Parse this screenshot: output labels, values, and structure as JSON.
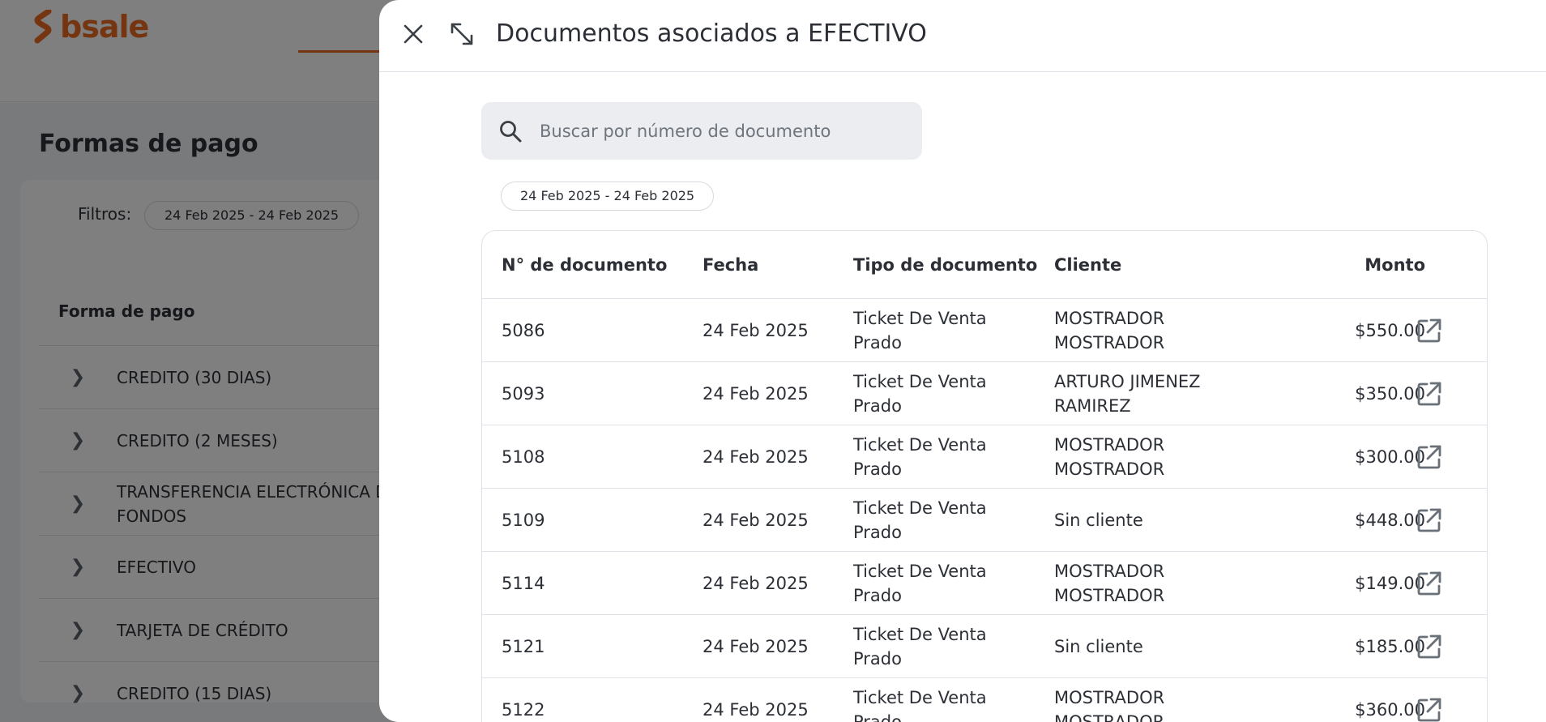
{
  "background": {
    "logo_text": "bsale",
    "page_title": "Formas de pago",
    "filters_label": "Filtros:",
    "filter_chip": "24 Feb 2025 - 24 Feb 2025",
    "column_header": "Forma de pago",
    "payment_methods": [
      {
        "label": "CREDITO (30 DIAS)"
      },
      {
        "label": "CREDITO (2 MESES)"
      },
      {
        "label": "TRANSFERENCIA ELECTRÓNICA DE",
        "label2": "FONDOS"
      },
      {
        "label": "EFECTIVO"
      },
      {
        "label": "TARJETA DE CRÉDITO"
      },
      {
        "label": "CREDITO (15 DIAS)"
      }
    ]
  },
  "modal": {
    "title": "Documentos asociados a EFECTIVO",
    "close_icon": "close-icon",
    "expand_icon": "expand-icon",
    "search": {
      "placeholder": "Buscar por número de documento",
      "value": ""
    },
    "date_chip": "24 Feb 2025 - 24 Feb 2025",
    "table": {
      "headers": {
        "doc_number": "N° de documento",
        "date": "Fecha",
        "doc_type": "Tipo de documento",
        "client": "Cliente",
        "amount": "Monto"
      },
      "rows": [
        {
          "doc_number": "5086",
          "date": "24 Feb 2025",
          "doc_type": "Ticket De Venta Prado",
          "client": "MOSTRADOR MOSTRADOR",
          "amount": "$550.00"
        },
        {
          "doc_number": "5093",
          "date": "24 Feb 2025",
          "doc_type": "Ticket De Venta Prado",
          "client": "ARTURO JIMENEZ RAMIREZ",
          "amount": "$350.00"
        },
        {
          "doc_number": "5108",
          "date": "24 Feb 2025",
          "doc_type": "Ticket De Venta Prado",
          "client": "MOSTRADOR MOSTRADOR",
          "amount": "$300.00"
        },
        {
          "doc_number": "5109",
          "date": "24 Feb 2025",
          "doc_type": "Ticket De Venta Prado",
          "client": "Sin cliente",
          "amount": "$448.00"
        },
        {
          "doc_number": "5114",
          "date": "24 Feb 2025",
          "doc_type": "Ticket De Venta Prado",
          "client": "MOSTRADOR MOSTRADOR",
          "amount": "$149.00"
        },
        {
          "doc_number": "5121",
          "date": "24 Feb 2025",
          "doc_type": "Ticket De Venta Prado",
          "client": "Sin cliente",
          "amount": "$185.00"
        },
        {
          "doc_number": "5122",
          "date": "24 Feb 2025",
          "doc_type": "Ticket De Venta Prado",
          "client": "MOSTRADOR MOSTRADOR",
          "amount": "$360.00"
        }
      ],
      "row_action_icon": "external-link-icon"
    }
  },
  "colors": {
    "brand": "#ec6a23",
    "overlay": "rgba(0,0,0,0.5)",
    "search_bg": "#ebedf0",
    "text": "#2c3036",
    "border": "#dfe2e6"
  }
}
